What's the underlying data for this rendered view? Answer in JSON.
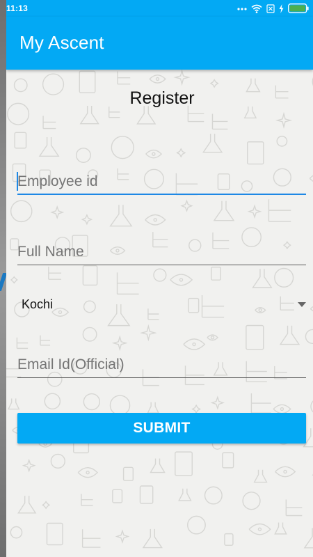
{
  "status_bar": {
    "time": "11:13",
    "icons": [
      "more-dots-icon",
      "wifi-icon",
      "sim-disabled-icon",
      "charging-icon",
      "battery-icon"
    ]
  },
  "app_bar": {
    "title": "My Ascent"
  },
  "form": {
    "title": "Register",
    "employee_id": {
      "placeholder": "Employee id",
      "value": ""
    },
    "full_name": {
      "placeholder": "Full Name",
      "value": ""
    },
    "location": {
      "selected": "Kochi"
    },
    "email": {
      "placeholder": "Email Id(Official)",
      "value": ""
    },
    "submit_label": "SUBMIT"
  },
  "colors": {
    "primary": "#03a9f4",
    "accent_focus": "#1e88e5",
    "background": "#f1f1ef",
    "battery": "#4caf50"
  }
}
